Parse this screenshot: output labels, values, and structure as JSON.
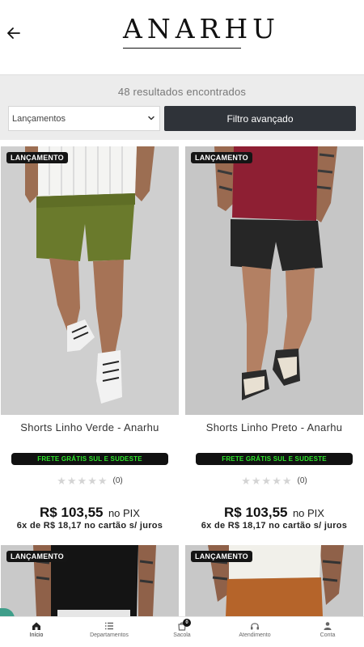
{
  "header": {
    "logo_text": "ANARHU"
  },
  "filters": {
    "results_text": "48 resultados encontrados",
    "sort_value": "Lançamentos",
    "advanced_label": "Filtro avançado"
  },
  "products": [
    {
      "badge": "LANÇAMENTO",
      "title": "Shorts Linho Verde - Anarhu",
      "shipping": "FRETE GRÁTIS SUL E SUDESTE",
      "rating_count": "(0)",
      "price": "R$ 103,55",
      "price_suffix": "no PIX",
      "installments": "6x de R$ 18,17 no cartão s/ juros"
    },
    {
      "badge": "LANÇAMENTO",
      "title": "Shorts Linho Preto - Anarhu",
      "shipping": "FRETE GRÁTIS SUL E SUDESTE",
      "rating_count": "(0)",
      "price": "R$ 103,55",
      "price_suffix": "no PIX",
      "installments": "6x de R$ 18,17 no cartão s/ juros"
    },
    {
      "badge": "LANÇAMENTO"
    },
    {
      "badge": "LANÇAMENTO"
    }
  ],
  "bottom_nav": {
    "items": [
      {
        "label": "Início",
        "icon": "home-icon"
      },
      {
        "label": "Departamentos",
        "icon": "list-icon"
      },
      {
        "label": "Sacola",
        "icon": "bag-icon",
        "badge": "0"
      },
      {
        "label": "Atendimento",
        "icon": "headset-icon"
      },
      {
        "label": "Conta",
        "icon": "user-icon"
      }
    ]
  },
  "colors": {
    "accent_dark": "#2f3339",
    "shipping_text": "#2de62b",
    "chat_button": "#3f9e8a"
  }
}
